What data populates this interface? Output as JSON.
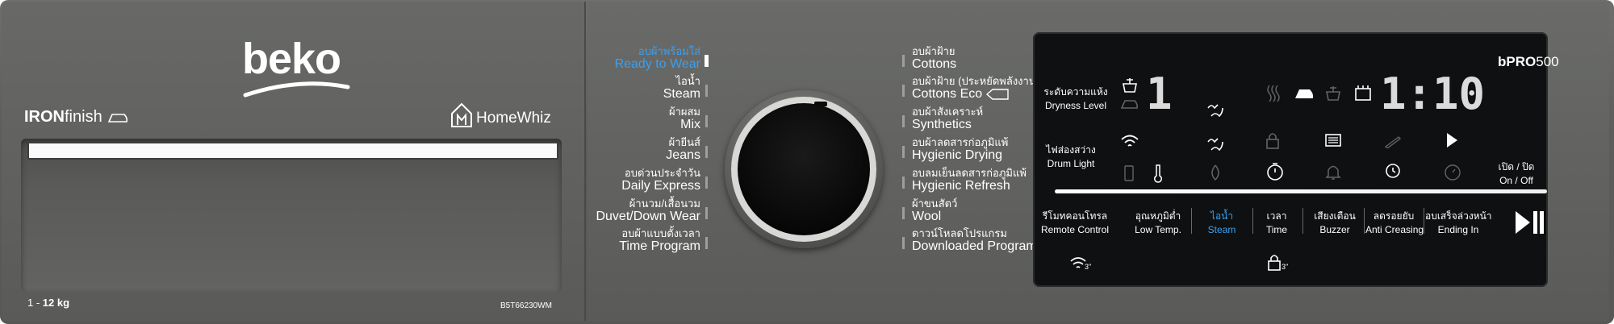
{
  "brand": {
    "logo": "beko",
    "feature": "IRON",
    "feature_suffix": "finish",
    "app": "HomeWhiz"
  },
  "capacity": {
    "prefix": "1 - ",
    "value": "12 kg"
  },
  "model": "B5T66230WM",
  "series": {
    "b": "bPRO",
    "n": "500"
  },
  "programs_left": [
    {
      "th": "อบผ้าพร้อมใส่",
      "en": "Ready to Wear",
      "selected": true
    },
    {
      "th": "ไอน้ำ",
      "en": "Steam",
      "selected": false
    },
    {
      "th": "ผ้าผสม",
      "en": "Mix",
      "selected": false
    },
    {
      "th": "ผ้ายีนส์",
      "en": "Jeans",
      "selected": false
    },
    {
      "th": "อบด่วนประจำวัน",
      "en": "Daily Express",
      "selected": false
    },
    {
      "th": "ผ้านวม/เสื้อนวม",
      "en": "Duvet/Down Wear",
      "selected": false
    },
    {
      "th": "อบผ้าแบบตั้งเวลา",
      "en": "Time Program",
      "selected": false
    }
  ],
  "programs_right": [
    {
      "th": "อบผ้าฝ้าย",
      "en": "Cottons"
    },
    {
      "th": "อบผ้าฝ้าย (ประหยัดพลังงาน)",
      "en": "Cottons Eco"
    },
    {
      "th": "อบผ้าสังเคราะห์",
      "en": "Synthetics"
    },
    {
      "th": "อบผ้าลดสารก่อภูมิแพ้",
      "en": "Hygienic Drying"
    },
    {
      "th": "อบลมเย็นลดสารก่อภูมิแพ้",
      "en": "Hygienic Refresh"
    },
    {
      "th": "ผ้าขนสัตว์",
      "en": "Wool"
    },
    {
      "th": "ดาวน์โหลดโปรแกรม",
      "en": "Downloaded Program"
    }
  ],
  "display": {
    "dryness": {
      "th": "ระดับความแห้ง",
      "en": "Dryness Level"
    },
    "drum_light": {
      "th": "ไฟส่องสว่าง",
      "en": "Drum Light"
    },
    "time_readout": "1:10",
    "level_digit": "1",
    "on_off": {
      "th": "เปิด / ปิด",
      "en": "On / Off"
    },
    "progress": 0.99
  },
  "buttons": [
    {
      "th": "รีโมทคอนโทรล",
      "en": "Remote Control",
      "active": false
    },
    {
      "th": "อุณหภูมิต่ำ",
      "en": "Low Temp.",
      "active": false
    },
    {
      "th": "ไอน้ำ",
      "en": "Steam",
      "active": true
    },
    {
      "th": "เวลา",
      "en": "Time",
      "active": false
    },
    {
      "th": "เสียงเตือน",
      "en": "Buzzer",
      "active": false
    },
    {
      "th": "ลดรอยยับ",
      "en": "Anti Creasing",
      "active": false
    },
    {
      "th": "อบเสร็จล่วงหน้า",
      "en": "Ending In",
      "active": false
    }
  ],
  "hold": {
    "wifi": "3\"",
    "lock": "3\""
  },
  "colors": {
    "accent": "#3aa0ef",
    "panel": "#5f605e",
    "display": "#0f1011"
  }
}
